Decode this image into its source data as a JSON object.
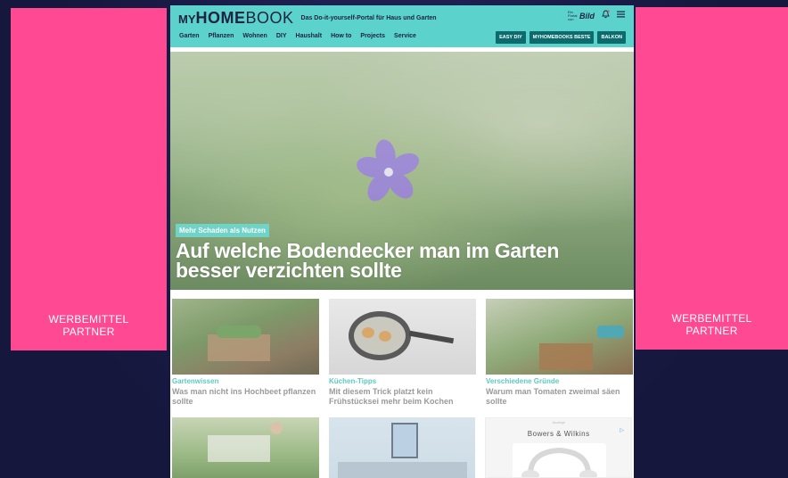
{
  "ads": {
    "left_label": "WERBEMITTEL\nPARTNER",
    "right_label": "WERBEMITTEL\nPARTNER"
  },
  "header": {
    "logo_my": "MY",
    "logo_home": "HOME",
    "logo_book": "BOOK",
    "tagline": "Das Do-it-yourself-Portal für Haus und Garten",
    "bild_small": "Ein Portal von",
    "bild": "Bild"
  },
  "nav": {
    "items": [
      "Garten",
      "Pflanzen",
      "Wohnen",
      "DIY",
      "Haushalt",
      "How to",
      "Projects",
      "Service"
    ],
    "pills": [
      "EASY DIY",
      "MYHOMEBOOKS BESTE",
      "BALKON"
    ]
  },
  "hero": {
    "kicker": "Mehr Schaden als Nutzen",
    "title": "Auf welche Bodendecker man im Garten besser verzichten sollte"
  },
  "cards": [
    {
      "kicker": "Gartenwissen",
      "title": "Was man nicht ins Hochbeet pflanzen sollte"
    },
    {
      "kicker": "Küchen-Tipps",
      "title": "Mit diesem Trick platzt kein Frühstücksei mehr beim Kochen"
    },
    {
      "kicker": "Verschiedene Gründe",
      "title": "Warum man Tomaten zweimal säen sollte"
    }
  ],
  "ad_tile": {
    "top": "Anzeige",
    "brand": "Bowers & Wilkins"
  },
  "colors": {
    "header_bg": "#5bd2cc",
    "pill_bg": "#0b6b6d",
    "ad_pink": "#ff4a93",
    "kicker": "#5ec9c0"
  }
}
